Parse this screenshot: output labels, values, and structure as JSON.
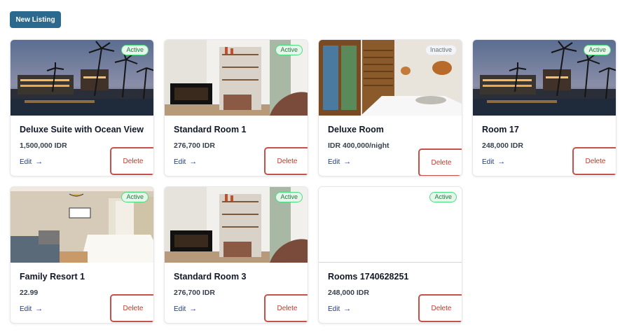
{
  "toolbar": {
    "new_listing_label": "New Listing"
  },
  "listings": [
    {
      "title": "Deluxe Suite with Ocean View",
      "price": "1,500,000 IDR",
      "status": "Active",
      "edit_label": "Edit",
      "delete_label": "Delete",
      "image": "resort-night"
    },
    {
      "title": "Standard Room 1",
      "price": "276,700 IDR",
      "status": "Active",
      "edit_label": "Edit",
      "delete_label": "Delete",
      "image": "living-room"
    },
    {
      "title": "Deluxe Room",
      "price": "IDR 400,000/night",
      "status": "Inactive",
      "edit_label": "Edit",
      "delete_label": "Delete",
      "image": "bedroom-wood"
    },
    {
      "title": "Room 17",
      "price": "248,000 IDR",
      "status": "Active",
      "edit_label": "Edit",
      "delete_label": "Delete",
      "image": "resort-night"
    },
    {
      "title": "Family Resort 1",
      "price": "22.99",
      "status": "Active",
      "edit_label": "Edit",
      "delete_label": "Delete",
      "image": "hotel-bedroom"
    },
    {
      "title": "Standard Room 3",
      "price": "276,700 IDR",
      "status": "Active",
      "edit_label": "Edit",
      "delete_label": "Delete",
      "image": "living-room"
    },
    {
      "title": "Rooms 1740628251",
      "price": "248,000 IDR",
      "status": "Active",
      "edit_label": "Edit",
      "delete_label": "Delete",
      "image": "blank"
    }
  ],
  "colors": {
    "primary": "#2b6a8e",
    "active_bg": "#e6f6ea",
    "active_fg": "#15803d",
    "delete_fg": "#c0392b",
    "highlight": "#c94f4a"
  },
  "icons": {
    "edit_arrow": "arrow-right-icon"
  }
}
